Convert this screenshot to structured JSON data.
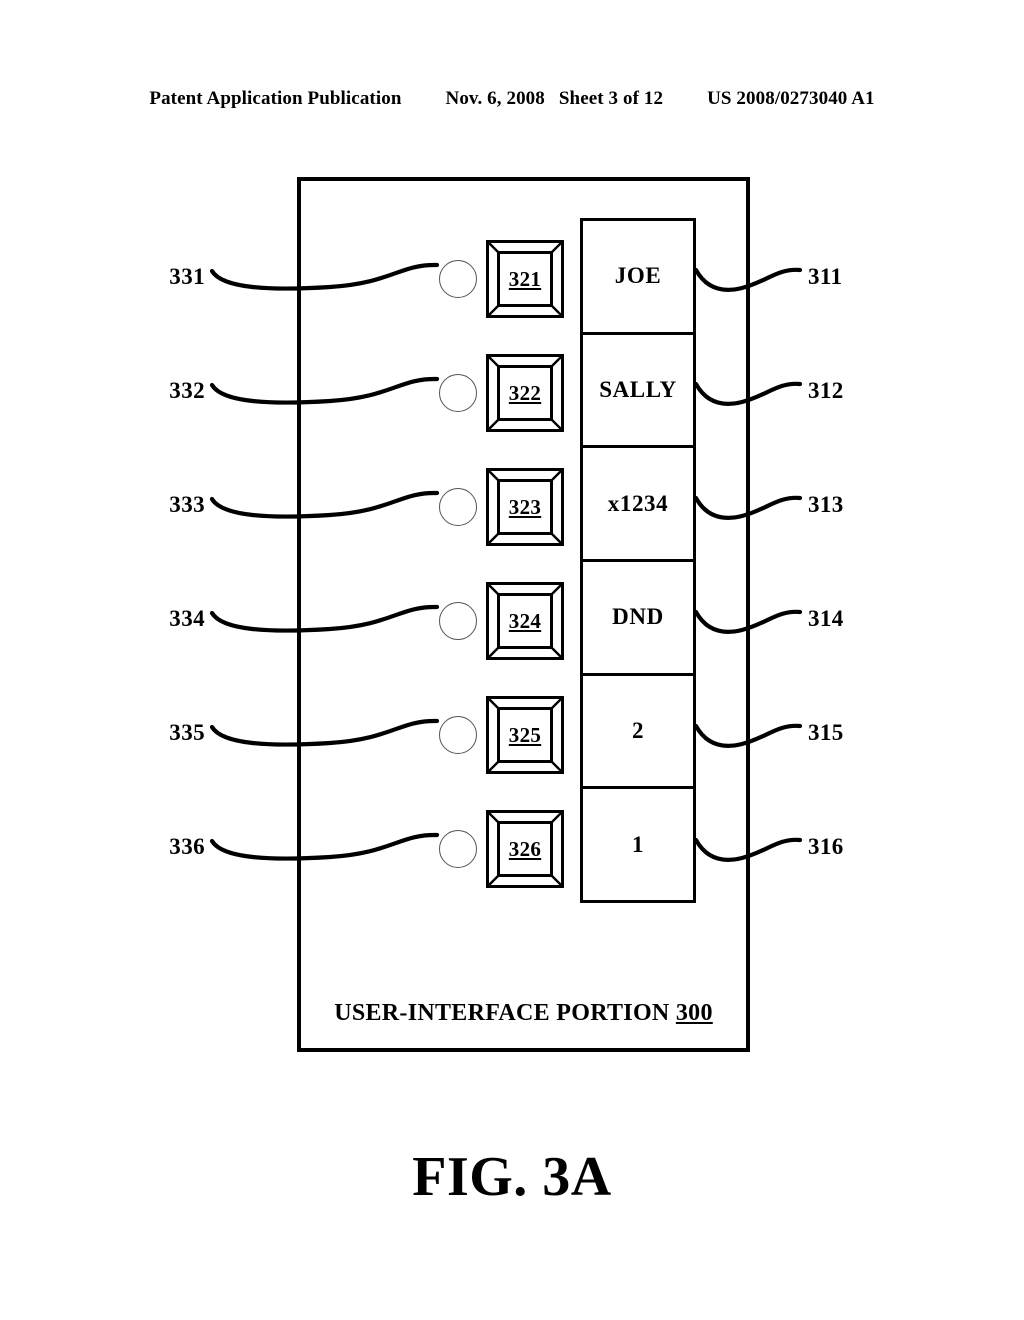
{
  "header": {
    "publication": "Patent Application Publication",
    "date": "Nov. 6, 2008",
    "sheet": "Sheet 3 of 12",
    "patent_number": "US 2008/0273040 A1"
  },
  "figure": {
    "caption": "FIG. 3A",
    "panel_caption_text": "USER-INTERFACE PORTION",
    "panel_caption_number": "300"
  },
  "rows": [
    {
      "button_label": "321",
      "display_text": "JOE",
      "left_ref": "331",
      "right_ref": "311"
    },
    {
      "button_label": "322",
      "display_text": "SALLY",
      "left_ref": "332",
      "right_ref": "312"
    },
    {
      "button_label": "323",
      "display_text": "x1234",
      "left_ref": "333",
      "right_ref": "313"
    },
    {
      "button_label": "324",
      "display_text": "DND",
      "left_ref": "334",
      "right_ref": "314"
    },
    {
      "button_label": "325",
      "display_text": "2",
      "left_ref": "335",
      "right_ref": "315"
    },
    {
      "button_label": "326",
      "display_text": "1",
      "left_ref": "336",
      "right_ref": "316"
    }
  ],
  "colors": {
    "ink": "#000000",
    "paper": "#ffffff",
    "led_stroke": "#555555"
  }
}
